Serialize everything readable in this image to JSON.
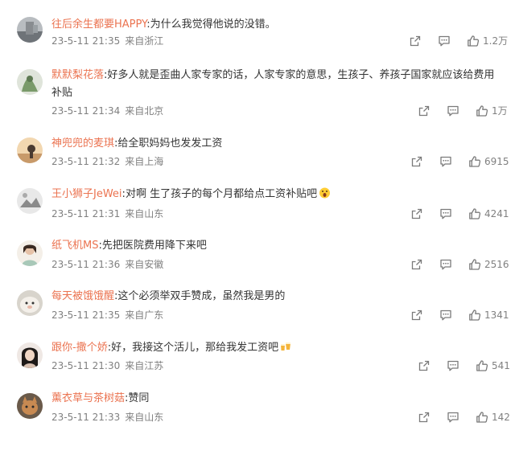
{
  "colors": {
    "username": "#eb7350",
    "text": "#333333",
    "meta": "#808080",
    "icon": "#7a7a7a"
  },
  "comments": [
    {
      "username": "往后余生都要HAPPY",
      "content": "为什么我觉得他说的没错。",
      "date": "23-5-11 21:35",
      "location": "来自浙江",
      "likes": "1.2万"
    },
    {
      "username": "默默梨花落",
      "content": "好多人就是歪曲人家专家的话，人家专家的意思，生孩子、养孩子国家就应该给费用补贴",
      "date": "23-5-11 21:34",
      "location": "来自北京",
      "likes": "1万"
    },
    {
      "username": "神兜兜的麦琪",
      "content": "给全职妈妈也发发工资",
      "date": "23-5-11 21:32",
      "location": "来自上海",
      "likes": "6915"
    },
    {
      "username": "王小狮子JeWei",
      "content": "对啊 生了孩子的每个月都给点工资补贴吧",
      "emoji": "scream-emoji",
      "date": "23-5-11 21:31",
      "location": "来自山东",
      "likes": "4241"
    },
    {
      "username": "纸飞机MS",
      "content": "先把医院费用降下来吧",
      "date": "23-5-11 21:36",
      "location": "来自安徽",
      "likes": "2516"
    },
    {
      "username": "每天被饿饿醒",
      "content": "这个必须举双手赞成，虽然我是男的",
      "date": "23-5-11 21:35",
      "location": "来自广东",
      "likes": "1341"
    },
    {
      "username": "跟你-撒个娇",
      "content": "好，我接这个活儿，那给我发工资吧",
      "emoji": "cheers-emoji",
      "date": "23-5-11 21:30",
      "location": "来自江苏",
      "likes": "541"
    },
    {
      "username": "薰衣草与茶树菇",
      "content": "赞同",
      "date": "23-5-11 21:33",
      "location": "来自山东",
      "likes": "142"
    }
  ]
}
